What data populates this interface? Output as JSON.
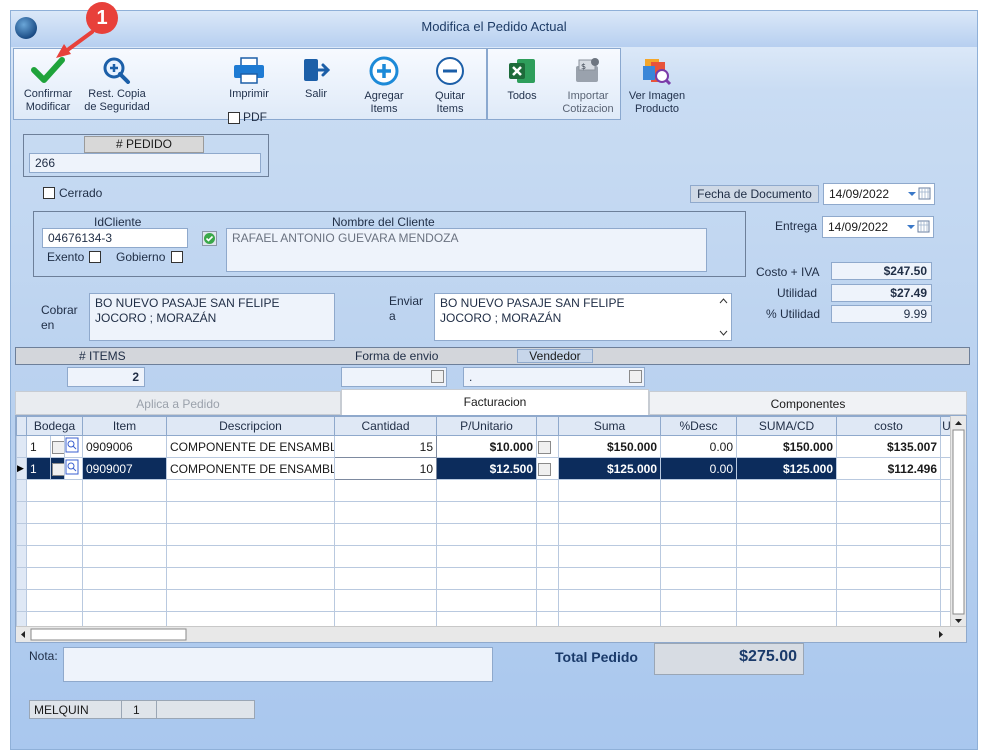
{
  "window": {
    "title": "Modifica el Pedido Actual"
  },
  "annotation": {
    "number": "1"
  },
  "toolbar": {
    "confirm": "Confirmar\nModificar",
    "restore": "Rest. Copia\nde Seguridad",
    "print": "Imprimir",
    "pdf": "PDF",
    "exit": "Salir",
    "add_items": "Agregar\nItems",
    "remove_items": "Quitar\nItems",
    "all": "Todos",
    "import_quote": "Importar\nCotizacion",
    "view_image": "Ver Imagen\nProducto"
  },
  "order": {
    "label": "# PEDIDO",
    "number": "266"
  },
  "closed": {
    "label": "Cerrado"
  },
  "doc_date": {
    "label": "Fecha de  Documento",
    "value": "14/09/2022"
  },
  "delivery": {
    "label": "Entrega",
    "value": "14/09/2022"
  },
  "client": {
    "id_label": "IdCliente",
    "id": "04676134-3",
    "name_label": "Nombre del Cliente",
    "name": "RAFAEL ANTONIO GUEVARA MENDOZA",
    "exempt_label": "Exento",
    "government_label": "Gobierno"
  },
  "totals": {
    "cost_iva_label": "Costo + IVA",
    "cost_iva": "$247.50",
    "utility_label": "Utilidad",
    "utility": "$27.49",
    "pct_utility_label": "% Utilidad",
    "pct_utility": "9.99"
  },
  "billing": {
    "label": "Cobrar\nen",
    "address": "BO NUEVO PASAJE SAN FELIPE\nJOCORO ; MORAZÁN"
  },
  "shipping": {
    "label": "Enviar\na",
    "address": "BO NUEVO PASAJE SAN FELIPE\nJOCORO ; MORAZÁN"
  },
  "summary": {
    "items_label": "# ITEMS",
    "items_count": "2",
    "ship_method_label": "Forma de envio",
    "seller_label": "Vendedor",
    "seller_value": "."
  },
  "tabs": [
    "Aplica a Pedido",
    "Facturacion",
    "Componentes"
  ],
  "grid": {
    "headers": [
      "Bodega",
      "Item",
      "Descripcion",
      "Cantidad",
      "P/Unitario",
      "Suma",
      "%Desc",
      "SUMA/CD",
      "costo",
      "U"
    ],
    "rows": [
      {
        "bodega": "1",
        "item": "0909006",
        "desc": "COMPONENTE DE ENSAMBL",
        "qty": "15",
        "unit": "$10.000",
        "sum": "$150.000",
        "disc": "0.00",
        "sumcd": "$150.000",
        "cost": "$135.007"
      },
      {
        "bodega": "1",
        "item": "0909007",
        "desc": "COMPONENTE DE ENSAMBL",
        "qty": "10",
        "unit": "$12.500",
        "sum": "$125.000",
        "disc": "0.00",
        "sumcd": "$125.000",
        "cost": "$112.496"
      }
    ]
  },
  "note": {
    "label": "Nota:",
    "value": ""
  },
  "total": {
    "label": "Total Pedido",
    "value": "$275.00"
  },
  "status": {
    "user": "MELQUIN",
    "session": "1",
    "extra": ""
  },
  "colors": {
    "accent": "#1a4b86",
    "selection": "#0c2c5c",
    "annotation": "#e8403a",
    "confirm": "#1fa33b"
  }
}
